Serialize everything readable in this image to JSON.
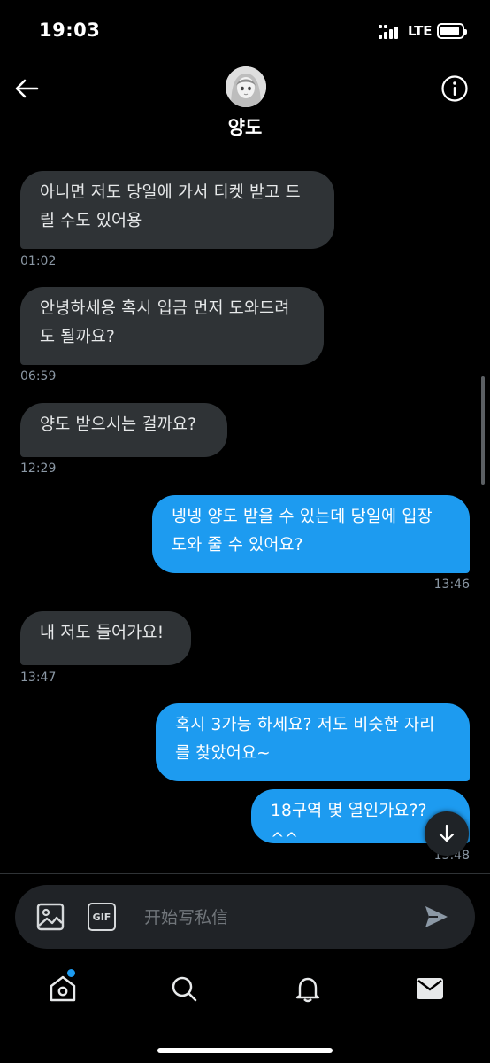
{
  "status_bar": {
    "time": "19:03",
    "network": "LTE"
  },
  "header": {
    "contact_name": "양도"
  },
  "messages": [
    {
      "direction": "received",
      "text": "아니면 저도 당일에 가서 티켓 받고 드\n릴 수도 있어용",
      "time": "01:02"
    },
    {
      "direction": "received",
      "text": "안녕하세용 혹시 입금 먼저 도와드려\n도 될까요?",
      "time": "06:59"
    },
    {
      "direction": "received",
      "text": "양도 받으시는 걸까요?",
      "time": "12:29"
    },
    {
      "direction": "sent",
      "text": "넹넹 양도 받을 수 있는데 당일에 입장\n도와 줄 수 있어요?",
      "time": "13:46"
    },
    {
      "direction": "received",
      "text": "내 저도 들어가요!",
      "time": "13:47"
    },
    {
      "direction": "sent",
      "text": "혹시 3가능 하세요? 저도 비슷한 자리\n를 찾았어요~",
      "time": ""
    },
    {
      "direction": "sent",
      "text": "18구역 몇 열인가요??^^",
      "time": "13:48"
    }
  ],
  "composer": {
    "placeholder": "开始写私信",
    "gif_label": "GIF"
  },
  "colors": {
    "accent": "#1d9bf0",
    "received_bubble": "#2f3336",
    "background": "#000000"
  },
  "icons": {
    "back": "back-arrow-icon",
    "info": "info-icon",
    "image": "image-icon",
    "gif": "gif-icon",
    "send": "send-icon",
    "scroll_down": "arrow-down-icon",
    "nav": [
      "home-icon",
      "search-icon",
      "notifications-icon",
      "messages-icon"
    ]
  }
}
